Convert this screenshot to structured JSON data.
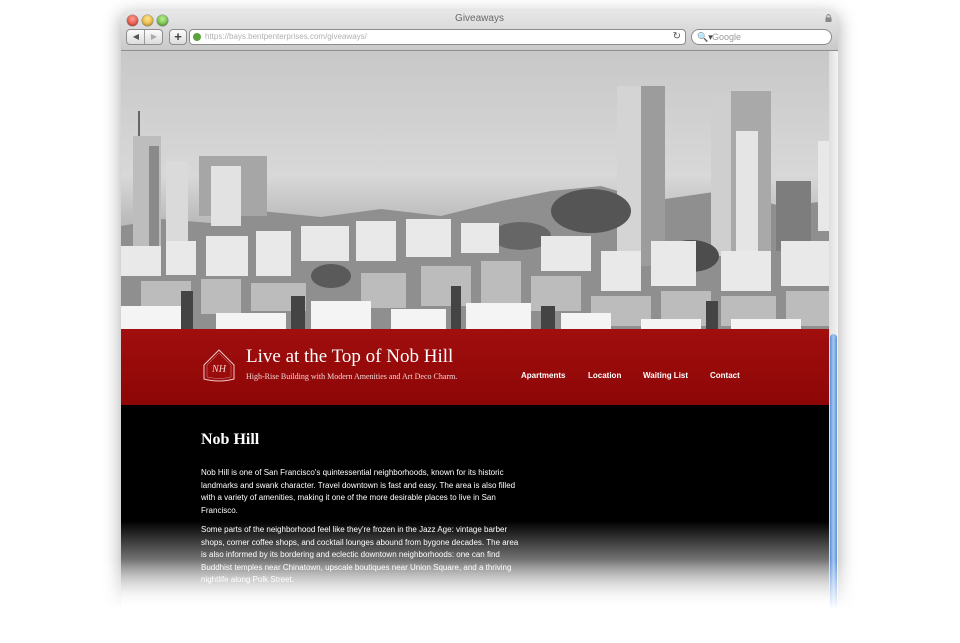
{
  "browser": {
    "window_title": "Giveaways",
    "url": "https://bays.bentpenterprises.com/giveaways/",
    "search_placeholder": "Google",
    "back_glyph": "◀",
    "forward_glyph": "▶",
    "add_glyph": "+",
    "reload_glyph": "↻",
    "search_glyph": "🔍▾"
  },
  "site": {
    "logo_monogram": "NH",
    "title": "Live at the Top of Nob Hill",
    "tagline": "High-Rise Building with Modern Amenities and Art Deco Charm.",
    "nav": [
      "Apartments",
      "Location",
      "Waiting List",
      "Contact"
    ]
  },
  "content": {
    "heading": "Nob Hill",
    "paragraphs": [
      "Nob Hill is one of San Francisco's quintessential neighborhoods, known for its historic landmarks and swank character. Travel downtown is fast and easy. The area is also filled with a variety of amenities, making it one of the more desirable places to live in San Francisco.",
      "Some parts of the neighborhood feel like they're frozen in the Jazz Age: vintage barber shops, corner coffee shops, and cocktail lounges abound from bygone decades. The area is also informed by its bordering and eclectic downtown neighborhoods: one can find Buddhist temples near Chinatown, upscale boutiques near Union Square, and a thriving nightlife along Polk Street."
    ]
  },
  "colors": {
    "banner_red": "#a10e0e",
    "content_bg": "#000000",
    "scroll_blue": "#5b8fd6"
  }
}
